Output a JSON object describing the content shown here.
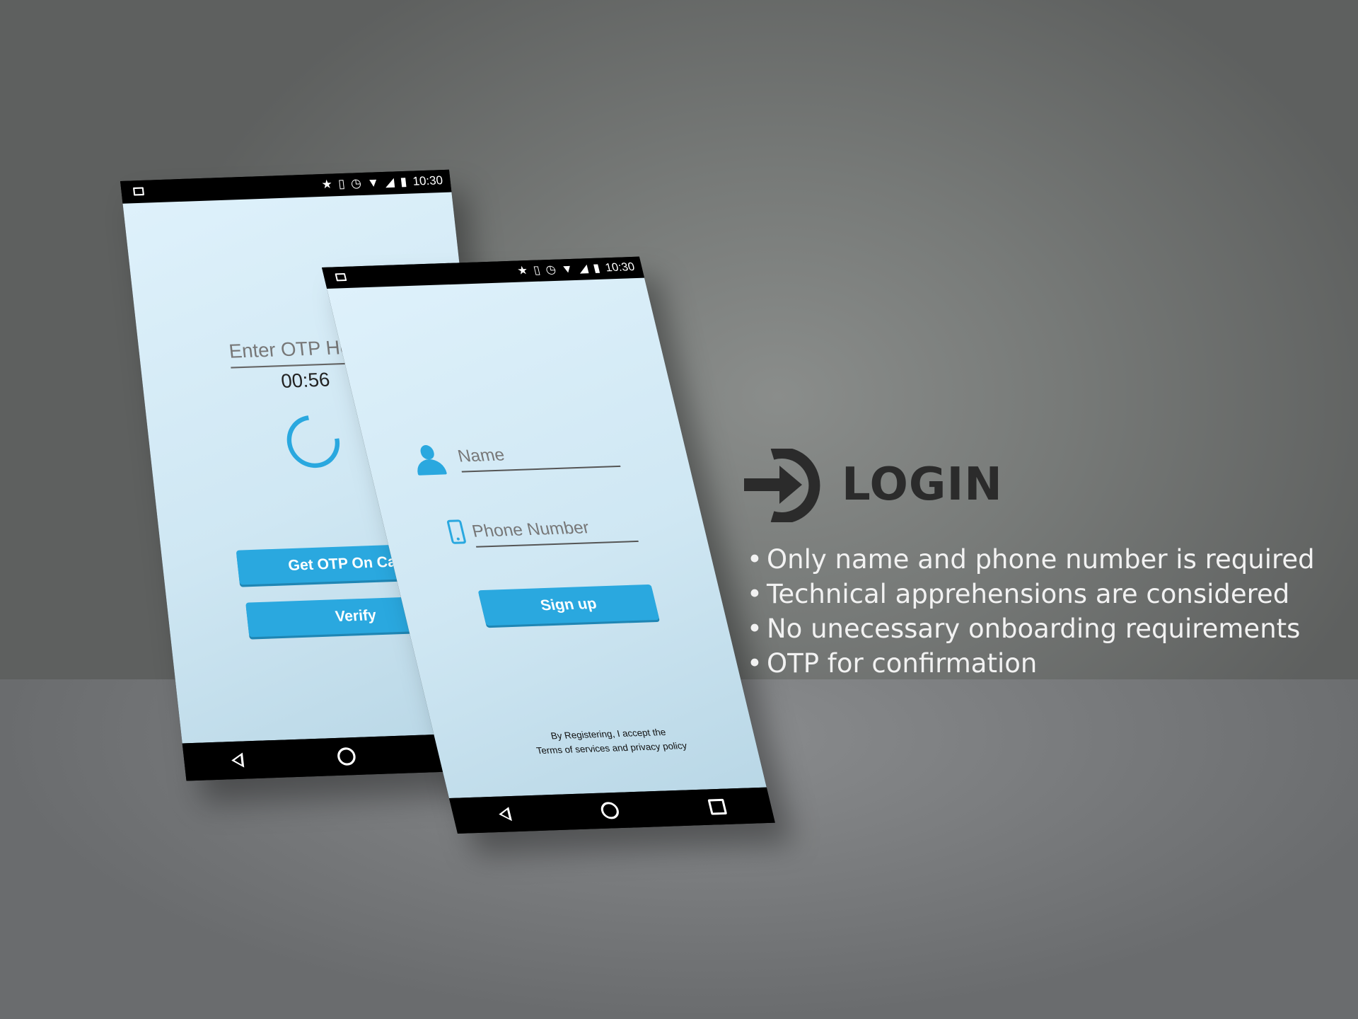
{
  "status_bar": {
    "time": "10:30"
  },
  "otp_screen": {
    "prompt": "Enter OTP Here",
    "timer": "00:56",
    "get_otp_button": "Get OTP On Call",
    "verify_button": "Verify"
  },
  "signup_screen": {
    "name_placeholder": "Name",
    "phone_placeholder": "Phone Number",
    "signup_button": "Sign up",
    "terms_line1": "By Registering, I accept the",
    "terms_line2": "Terms of services and privacy policy"
  },
  "info": {
    "title": "LOGIN",
    "features": [
      "Only name and phone number is required",
      "Technical apprehensions are considered",
      "No unecessary onboarding requirements",
      "OTP for confirmation"
    ]
  },
  "colors": {
    "accent": "#2aa8df",
    "screen_bg": "#def1fb",
    "title": "#2b2b2b"
  }
}
